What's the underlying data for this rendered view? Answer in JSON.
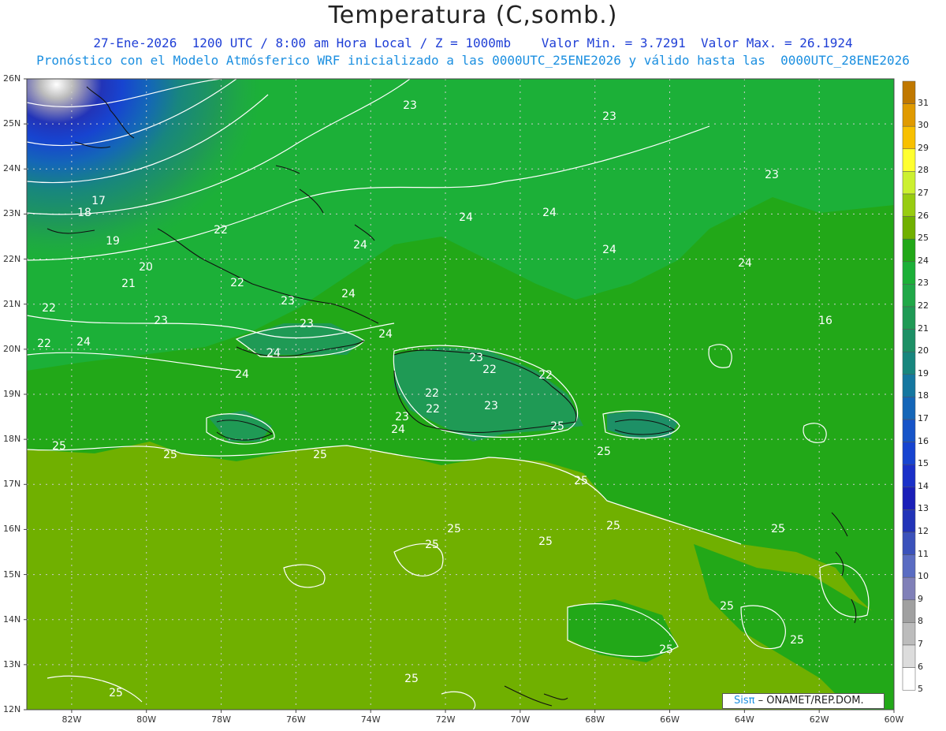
{
  "title": "Temperatura (C,somb.)",
  "subtitle1": "27-Ene-2026  1200 UTC / 8:00 am Hora Local / Z = 1000mb    Valor Min. = 3.7291  Valor Max. = 26.1924",
  "subtitle2": "Pronóstico con el Modelo Atmósferico WRF inicializado a las 0000UTC_25ENE2026 y válido hasta las  0000UTC_28ENE2026",
  "credit": {
    "logo_text": "Sisπ",
    "text": " – ONAMET/REP.DOM."
  },
  "map": {
    "lat_labels": [
      "26N",
      "25N",
      "24N",
      "23N",
      "22N",
      "21N",
      "20N",
      "19N",
      "18N",
      "17N",
      "16N",
      "15N",
      "14N",
      "13N",
      "12N"
    ],
    "lon_labels": [
      "82W",
      "80W",
      "78W",
      "76W",
      "74W",
      "72W",
      "70W",
      "68W",
      "66W",
      "64W",
      "62W",
      "60W"
    ],
    "lat_range": [
      12,
      26
    ],
    "lon_range": [
      -83.2,
      -60
    ],
    "colorbar": {
      "values": [
        "31",
        "30",
        "29",
        "28",
        "27",
        "26",
        "25",
        "24",
        "23",
        "22",
        "21",
        "20",
        "19",
        "18",
        "17",
        "16",
        "15",
        "14",
        "13",
        "12",
        "11",
        "10",
        "9",
        "8",
        "7",
        "6",
        "5"
      ],
      "colors": [
        "#c07800",
        "#e09a00",
        "#f8c000",
        "#ffff30",
        "#ccf030",
        "#98cc10",
        "#70b000",
        "#22a818",
        "#1cb038",
        "#20a848",
        "#1f9a55",
        "#1d9066",
        "#18867e",
        "#1577a0",
        "#1466b8",
        "#1654c8",
        "#1744d0",
        "#1a30c8",
        "#1a1fb8",
        "#2234b8",
        "#3b52bb",
        "#5a6cc2",
        "#8080b8",
        "#a0a0a0",
        "#bcbcbc",
        "#dcdcdc",
        "#ffffff"
      ]
    },
    "contour_labels": [
      "23",
      "23",
      "23",
      "24",
      "24",
      "24",
      "24",
      "16",
      "17",
      "18",
      "19",
      "20",
      "21",
      "22",
      "22",
      "22",
      "22",
      "23",
      "23",
      "23",
      "24",
      "24",
      "24",
      "24",
      "22",
      "22",
      "22",
      "22",
      "23",
      "23",
      "23",
      "24",
      "24",
      "24",
      "25",
      "25",
      "25",
      "25",
      "25",
      "25",
      "25",
      "25",
      "25",
      "25",
      "25",
      "25",
      "25",
      "25",
      "25",
      "25"
    ]
  }
}
